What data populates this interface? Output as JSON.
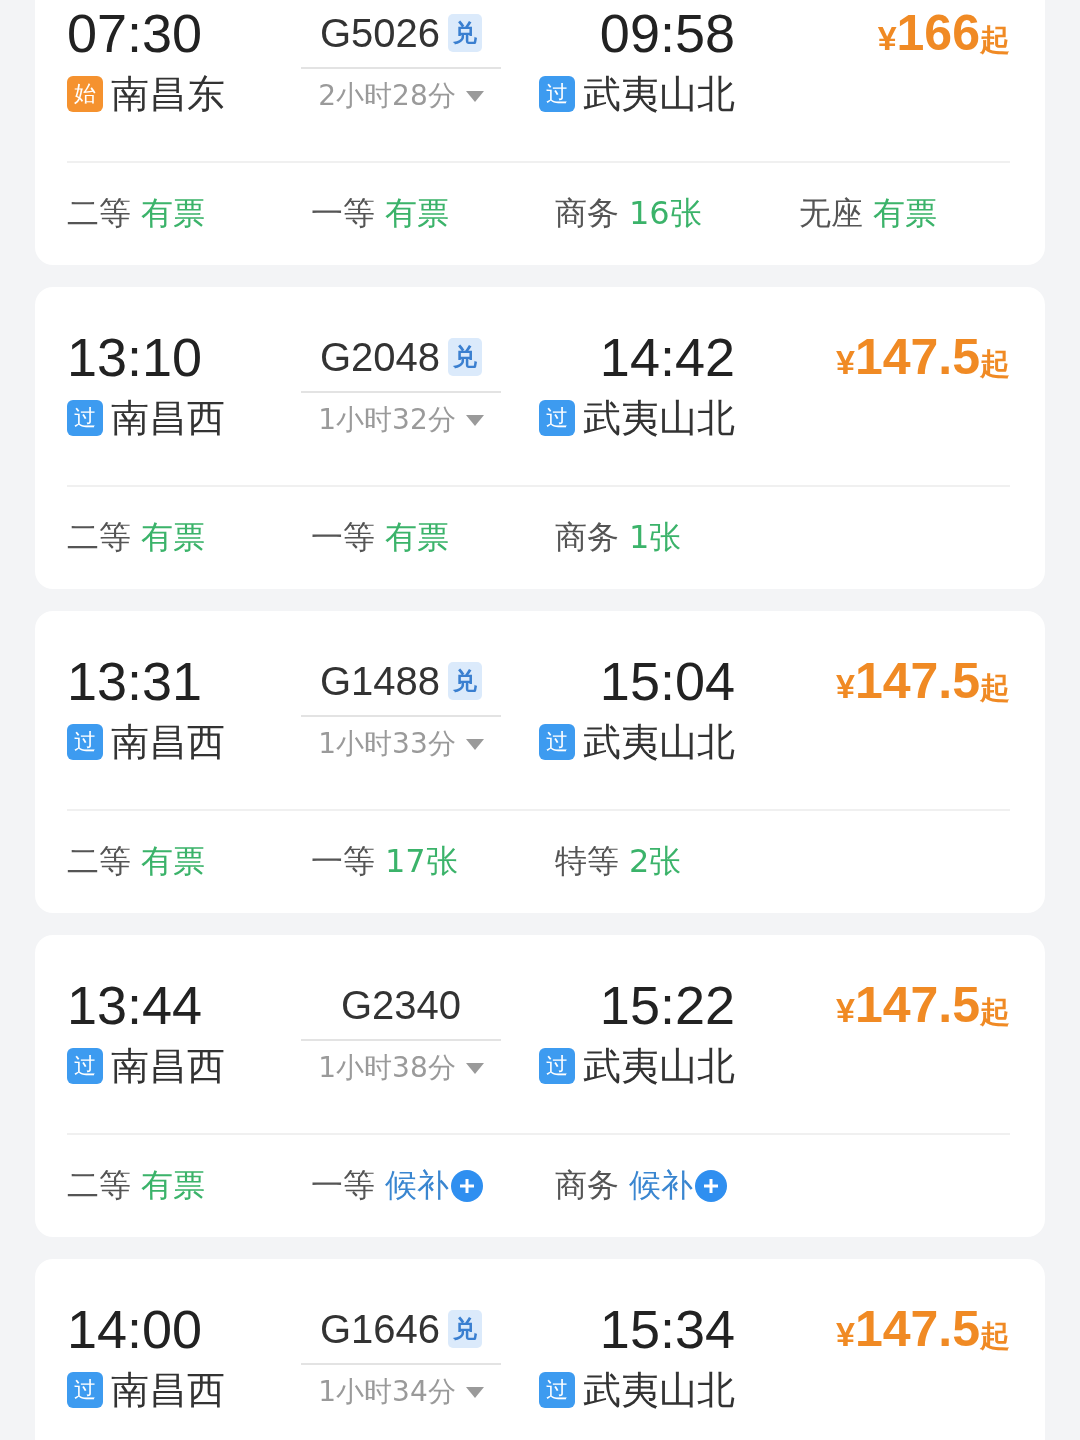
{
  "trains": [
    {
      "dep_time": "07:30",
      "dep_tag": {
        "kind": "start",
        "label": "始"
      },
      "dep_station": "南昌东",
      "train_no": "G5026",
      "exchange_badge": "兑",
      "duration": "2小时28分",
      "arr_time": "09:58",
      "arr_tag": {
        "kind": "pass",
        "label": "过"
      },
      "arr_station": "武夷山北",
      "price": {
        "currency": "¥",
        "amount": "166",
        "suffix": "起"
      },
      "seats": [
        {
          "class": "二等",
          "availability": "有票",
          "kind": "available"
        },
        {
          "class": "一等",
          "availability": "有票",
          "kind": "available"
        },
        {
          "class": "商务",
          "availability": "16张",
          "kind": "available"
        },
        {
          "class": "无座",
          "availability": "有票",
          "kind": "available"
        }
      ]
    },
    {
      "dep_time": "13:10",
      "dep_tag": {
        "kind": "pass",
        "label": "过"
      },
      "dep_station": "南昌西",
      "train_no": "G2048",
      "exchange_badge": "兑",
      "duration": "1小时32分",
      "arr_time": "14:42",
      "arr_tag": {
        "kind": "pass",
        "label": "过"
      },
      "arr_station": "武夷山北",
      "price": {
        "currency": "¥",
        "amount": "147.5",
        "suffix": "起"
      },
      "seats": [
        {
          "class": "二等",
          "availability": "有票",
          "kind": "available"
        },
        {
          "class": "一等",
          "availability": "有票",
          "kind": "available"
        },
        {
          "class": "商务",
          "availability": "1张",
          "kind": "available"
        }
      ]
    },
    {
      "dep_time": "13:31",
      "dep_tag": {
        "kind": "pass",
        "label": "过"
      },
      "dep_station": "南昌西",
      "train_no": "G1488",
      "exchange_badge": "兑",
      "duration": "1小时33分",
      "arr_time": "15:04",
      "arr_tag": {
        "kind": "pass",
        "label": "过"
      },
      "arr_station": "武夷山北",
      "price": {
        "currency": "¥",
        "amount": "147.5",
        "suffix": "起"
      },
      "seats": [
        {
          "class": "二等",
          "availability": "有票",
          "kind": "available"
        },
        {
          "class": "一等",
          "availability": "17张",
          "kind": "available"
        },
        {
          "class": "特等",
          "availability": "2张",
          "kind": "available"
        }
      ]
    },
    {
      "dep_time": "13:44",
      "dep_tag": {
        "kind": "pass",
        "label": "过"
      },
      "dep_station": "南昌西",
      "train_no": "G2340",
      "duration": "1小时38分",
      "arr_time": "15:22",
      "arr_tag": {
        "kind": "pass",
        "label": "过"
      },
      "arr_station": "武夷山北",
      "price": {
        "currency": "¥",
        "amount": "147.5",
        "suffix": "起"
      },
      "seats": [
        {
          "class": "二等",
          "availability": "有票",
          "kind": "available"
        },
        {
          "class": "一等",
          "availability": "候补",
          "kind": "waitlist"
        },
        {
          "class": "商务",
          "availability": "候补",
          "kind": "waitlist"
        }
      ]
    },
    {
      "dep_time": "14:00",
      "dep_tag": {
        "kind": "pass",
        "label": "过"
      },
      "dep_station": "南昌西",
      "train_no": "G1646",
      "exchange_badge": "兑",
      "duration": "1小时34分",
      "arr_time": "15:34",
      "arr_tag": {
        "kind": "pass",
        "label": "过"
      },
      "arr_station": "武夷山北",
      "price": {
        "currency": "¥",
        "amount": "147.5",
        "suffix": "起"
      }
    }
  ]
}
